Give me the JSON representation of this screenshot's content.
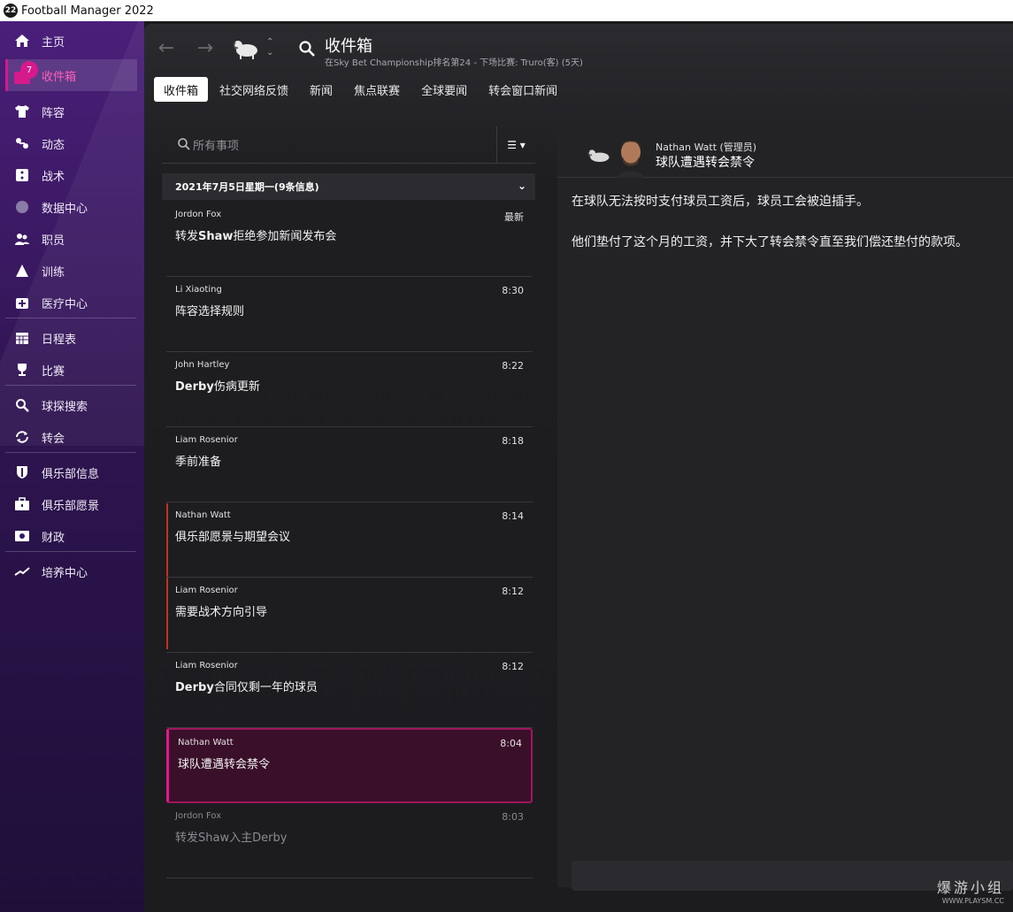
{
  "window": {
    "title": "Football Manager 2022",
    "logo_text": "22"
  },
  "sidebar": {
    "items": [
      {
        "label": "主页",
        "icon": "home-icon"
      },
      {
        "label": "收件箱",
        "icon": "inbox-icon",
        "badge": "7",
        "active": true
      },
      {
        "label": "阵容",
        "icon": "squad-shirt-icon"
      },
      {
        "label": "动态",
        "icon": "dynamics-icon"
      },
      {
        "label": "战术",
        "icon": "tactics-icon"
      },
      {
        "label": "数据中心",
        "icon": "data-hub-icon"
      },
      {
        "label": "职员",
        "icon": "staff-icon"
      },
      {
        "label": "训练",
        "icon": "training-icon"
      },
      {
        "label": "医疗中心",
        "icon": "medical-icon"
      },
      {
        "label": "日程表",
        "icon": "calendar-icon"
      },
      {
        "label": "比赛",
        "icon": "trophy-icon"
      },
      {
        "label": "球探搜索",
        "icon": "scouting-icon"
      },
      {
        "label": "转会",
        "icon": "transfers-icon"
      },
      {
        "label": "俱乐部信息",
        "icon": "club-shield-icon"
      },
      {
        "label": "俱乐部愿景",
        "icon": "briefcase-icon"
      },
      {
        "label": "财政",
        "icon": "finances-icon"
      },
      {
        "label": "培养中心",
        "icon": "development-icon"
      }
    ]
  },
  "header": {
    "title": "收件箱",
    "subtitle": "在Sky Bet Championship排名第24 - 下场比赛: Truro(客) (5天)"
  },
  "tabs": [
    {
      "label": "收件箱",
      "active": true
    },
    {
      "label": "社交网络反馈"
    },
    {
      "label": "新闻"
    },
    {
      "label": "焦点联赛"
    },
    {
      "label": "全球要闻"
    },
    {
      "label": "转会窗口新闻"
    }
  ],
  "list": {
    "search_placeholder": "所有事项",
    "date_header": "2021年7月5日星期一(9条信息)",
    "messages": [
      {
        "sender": "Jordon Fox",
        "time": "最新",
        "subject_bold": "",
        "subject": "转发",
        "subject_bold2": "Shaw",
        "subject_rest": "拒绝参加新闻发布会"
      },
      {
        "sender": "Li Xiaoting",
        "time": "8:30",
        "subject_bold": "",
        "subject": "阵容选择规则",
        "subject_bold2": "",
        "subject_rest": ""
      },
      {
        "sender": "John Hartley",
        "time": "8:22",
        "subject_bold": "Derby",
        "subject": "伤病更新",
        "subject_bold2": "",
        "subject_rest": ""
      },
      {
        "sender": "Liam Rosenior",
        "time": "8:18",
        "subject_bold": "",
        "subject": "季前准备",
        "subject_bold2": "",
        "subject_rest": ""
      },
      {
        "sender": "Nathan Watt",
        "time": "8:14",
        "subject_bold": "",
        "subject": "俱乐部愿景与期望会议",
        "subject_bold2": "",
        "subject_rest": ""
      },
      {
        "sender": "Liam Rosenior",
        "time": "8:12",
        "subject_bold": "",
        "subject": "需要战术方向引导",
        "subject_bold2": "",
        "subject_rest": ""
      },
      {
        "sender": "Liam Rosenior",
        "time": "8:12",
        "subject_bold": "Derby",
        "subject": "合同仅剩一年的球员",
        "subject_bold2": "",
        "subject_rest": ""
      },
      {
        "sender": "Nathan Watt",
        "time": "8:04",
        "subject_bold": "",
        "subject": "球队遭遇转会禁令",
        "subject_bold2": "",
        "subject_rest": "",
        "selected": true
      },
      {
        "sender": "Jordon Fox",
        "time": "8:03",
        "subject_bold": "",
        "subject": "转发Shaw入主Derby",
        "subject_bold2": "",
        "subject_rest": "",
        "read": true
      }
    ]
  },
  "detail": {
    "from": "Nathan Watt (管理员)",
    "subject": "球队遭遇转会禁令",
    "body": [
      "在球队无法按时支付球员工资后，球员工会被迫插手。",
      "他们垫付了这个月的工资，并下大了转会禁令直至我们偿还垫付的款项。"
    ]
  },
  "watermark": {
    "text": "爆游小组",
    "url": "WWW.PLAYSM.CC"
  },
  "colors": {
    "accent": "#d51a8c",
    "sidebar": "#3a1866",
    "selected_row": "#3a0f2a",
    "alert_line": "#c2301f"
  }
}
